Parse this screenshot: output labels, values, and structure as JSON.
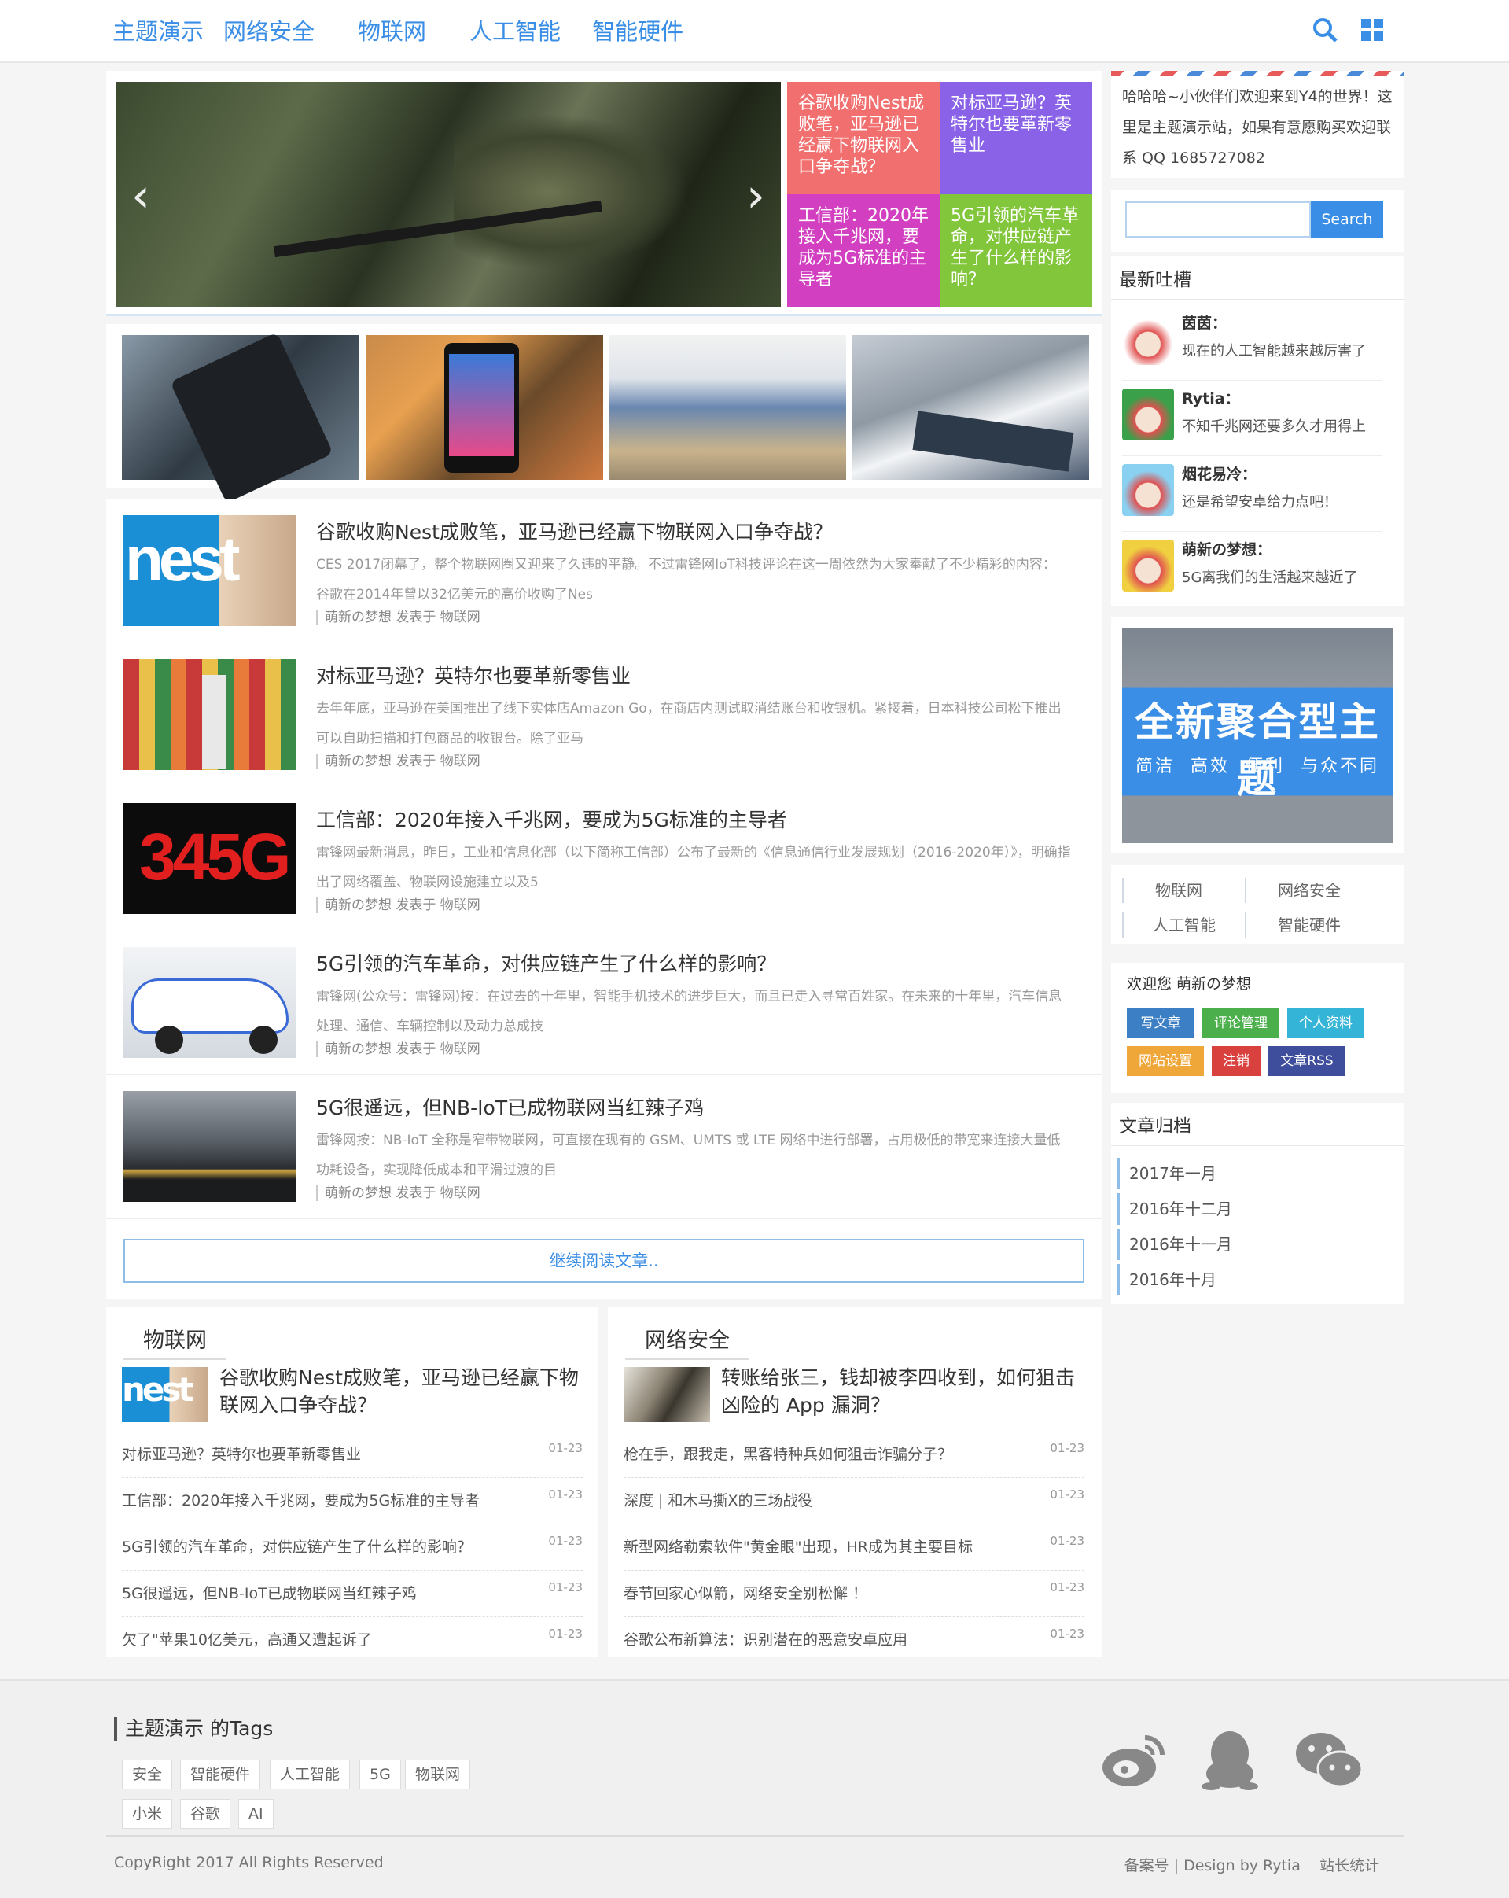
{
  "nav": {
    "items": [
      "主题演示",
      "网络安全",
      "物联网",
      "人工智能",
      "智能硬件"
    ],
    "icons": [
      "search-icon",
      "grid-icon"
    ],
    "accent": "#3a8ee6"
  },
  "slider": {
    "tiles": [
      {
        "text": "谷歌收购Nest成败笔，亚马逊已经赢下物联网入口争夺战？",
        "color": "#f26f6f"
      },
      {
        "text": "对标亚马逊？英特尔也要革新零售业",
        "color": "#8a62e8"
      },
      {
        "text": "工信部：2020年接入千兆网，要成为5G标准的主导者",
        "color": "#d23fc0"
      },
      {
        "text": "5G引领的汽车革命，对供应链产生了什么样的影响？",
        "color": "#82c63c"
      }
    ]
  },
  "posts": [
    {
      "title": "谷歌收购Nest成败笔，亚马逊已经赢下物联网入口争夺战？",
      "excerpt": "CES 2017闭幕了，整个物联网圈又迎来了久违的平静。不过雷锋网IoT科技评论在这一周依然为大家奉献了不少精彩的内容： 谷歌在2014年曾以32亿美元的高价收购了Nes",
      "meta": "萌新の梦想 发表于 物联网"
    },
    {
      "title": "对标亚马逊？英特尔也要革新零售业",
      "excerpt": "去年年底，亚马逊在美国推出了线下实体店Amazon Go，在商店内测试取消结账台和收银机。紧接着，日本科技公司松下推出可以自助扫描和打包商品的收银台。除了亚马",
      "meta": "萌新の梦想 发表于 物联网"
    },
    {
      "title": "工信部：2020年接入千兆网，要成为5G标准的主导者",
      "excerpt": "雷锋网最新消息，昨日，工业和信息化部（以下简称工信部）公布了最新的《信息通信行业发展规划（2016-2020年）》，明确指出了网络覆盖、物联网设施建立以及5",
      "meta": "萌新の梦想 发表于 物联网"
    },
    {
      "title": "5G引领的汽车革命，对供应链产生了什么样的影响？",
      "excerpt": "雷锋网(公众号：雷锋网)按：在过去的十年里，智能手机技术的进步巨大，而且已走入寻常百姓家。在未来的十年里，汽车信息处理、通信、车辆控制以及动力总成技",
      "meta": "萌新の梦想 发表于 物联网"
    },
    {
      "title": "5G很遥远，但NB-IoT已成物联网当红辣子鸡",
      "excerpt": "雷锋网按：NB-IoT 全称是窄带物联网，可直接在现有的 GSM、UMTS 或 LTE 网络中进行部署，占用极低的带宽来连接大量低功耗设备，实现降低成本和平滑过渡的目",
      "meta": "萌新の梦想 发表于 物联网"
    }
  ],
  "more_label": "继续阅读文章..",
  "cats": [
    {
      "title": "物联网",
      "feature": "谷歌收购Nest成败笔，亚马逊已经赢下物联网入口争夺战？",
      "items": [
        {
          "t": "对标亚马逊？英特尔也要革新零售业",
          "d": "01-23"
        },
        {
          "t": "工信部：2020年接入千兆网，要成为5G标准的主导者",
          "d": "01-23"
        },
        {
          "t": "5G引领的汽车革命，对供应链产生了什么样的影响？",
          "d": "01-23"
        },
        {
          "t": "5G很遥远，但NB-IoT已成物联网当红辣子鸡",
          "d": "01-23"
        },
        {
          "t": "欠了\"苹果10亿美元，高通又遭起诉了",
          "d": "01-23"
        }
      ]
    },
    {
      "title": "网络安全",
      "feature": "转账给张三，钱却被李四收到，如何狙击凶险的 App 漏洞？",
      "items": [
        {
          "t": "枪在手，跟我走，黑客特种兵如何狙击诈骗分子？",
          "d": "01-23"
        },
        {
          "t": "深度 | 和木马撕X的三场战役",
          "d": "01-23"
        },
        {
          "t": "新型网络勒索软件\"黄金眼\"出现，HR成为其主要目标",
          "d": "01-23"
        },
        {
          "t": "春节回家心似箭，网络安全别松懈 ！",
          "d": "01-23"
        },
        {
          "t": "谷歌公布新算法：识别潜在的恶意安卓应用",
          "d": "01-23"
        }
      ]
    }
  ],
  "side": {
    "welcome": "哈哈哈~小伙伴们欢迎来到Y4的世界！这里是主题演示站，如果有意愿购买欢迎联系 QQ 1685727082",
    "search_button": "Search",
    "comments_title": "最新吐槽",
    "comments": [
      {
        "name": "茵茵：",
        "text": "现在的人工智能越来越厉害了"
      },
      {
        "name": "Rytia：",
        "text": "不知千兆网还要多久才用得上"
      },
      {
        "name": "烟花易冷：",
        "text": "还是希望安卓给力点吧！"
      },
      {
        "name": "萌新の梦想：",
        "text": "5G离我们的生活越来越近了"
      }
    ],
    "banner": {
      "title": "全新聚合型主题",
      "sub": "简洁  高效  便利  与众不同"
    },
    "cats": [
      "物联网",
      "网络安全",
      "人工智能",
      "智能硬件"
    ],
    "admin": {
      "greeting": "欢迎您 萌新の梦想",
      "buttons": [
        {
          "l": "写文章",
          "c": "#3d7fc4"
        },
        {
          "l": "评论管理",
          "c": "#4bb04b"
        },
        {
          "l": "个人资料",
          "c": "#34b4d6"
        },
        {
          "l": "网站设置",
          "c": "#f0a73a"
        },
        {
          "l": "注销",
          "c": "#d9413e"
        },
        {
          "l": "文章RSS",
          "c": "#3f4e9c"
        }
      ]
    },
    "archive_title": "文章归档",
    "archive": [
      "2017年一月",
      "2016年十二月",
      "2016年十一月",
      "2016年十月"
    ]
  },
  "footer": {
    "tags_title": "主题演示 的Tags",
    "tags": [
      "安全",
      "智能硬件",
      "人工智能",
      "5G",
      "物联网",
      "小米",
      "谷歌",
      "AI"
    ],
    "copyright": "CopyRight 2017 All Rights Reserved",
    "links": "备案号 | Design by Rytia    站长统计",
    "social": [
      "weibo-icon",
      "qq-icon",
      "wechat-icon"
    ]
  }
}
